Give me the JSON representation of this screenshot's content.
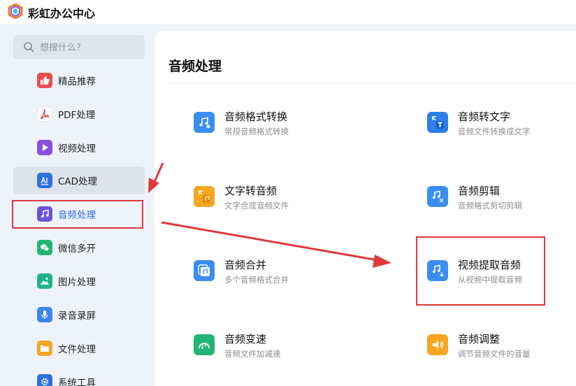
{
  "app": {
    "title": "彩虹办公中心"
  },
  "search": {
    "placeholder": "想搜什么?"
  },
  "sidebar": {
    "items": [
      {
        "label": "精品推荐",
        "icon": "thumbs-up-icon",
        "color": "#e94c4c"
      },
      {
        "label": "PDF处理",
        "icon": "pdf-icon",
        "color": "#ffffff"
      },
      {
        "label": "视频处理",
        "icon": "video-play-icon",
        "color": "#8a4fe0"
      },
      {
        "label": "CAD处理",
        "icon": "cad-icon",
        "color": "#2f6fe0"
      },
      {
        "label": "音频处理",
        "icon": "music-note-icon",
        "color": "#6a54d9"
      },
      {
        "label": "微信多开",
        "icon": "wechat-icon",
        "color": "#22b573"
      },
      {
        "label": "图片处理",
        "icon": "image-icon",
        "color": "#1fb38a"
      },
      {
        "label": "录音录屏",
        "icon": "microphone-icon",
        "color": "#3c86f0"
      },
      {
        "label": "文件处理",
        "icon": "folder-icon",
        "color": "#f5a623"
      },
      {
        "label": "系统工具",
        "icon": "gear-icon",
        "color": "#2f6fe0"
      }
    ]
  },
  "main": {
    "title": "音频处理",
    "cards": [
      {
        "title": "音频格式转换",
        "subtitle": "常规音频格式转换",
        "icon": "audio-convert-icon",
        "color": "#3a8df2"
      },
      {
        "title": "音频转文字",
        "subtitle": "音频文件转换成文字",
        "icon": "audio-to-text-icon",
        "color": "#2d7ee8"
      },
      {
        "title": "文字转音频",
        "subtitle": "文字合成音频文件",
        "icon": "text-to-audio-icon",
        "color": "#f5a623"
      },
      {
        "title": "音频剪辑",
        "subtitle": "音频格式剪切剪辑",
        "icon": "audio-cut-icon",
        "color": "#3a8df2"
      },
      {
        "title": "音频合并",
        "subtitle": "多个音频格式合并",
        "icon": "audio-merge-icon",
        "color": "#3a8df2"
      },
      {
        "title": "视频提取音频",
        "subtitle": "从视频中提取音频",
        "icon": "video-extract-audio-icon",
        "color": "#3a8df2"
      },
      {
        "title": "音频变速",
        "subtitle": "音频文件加减速",
        "icon": "audio-speed-icon",
        "color": "#22b573"
      },
      {
        "title": "音频调整",
        "subtitle": "调节音频文件的音量",
        "icon": "volume-icon",
        "color": "#f5a623"
      }
    ]
  },
  "colors": {
    "accent": "#2d6ad8",
    "highlight": "#e0393d"
  }
}
